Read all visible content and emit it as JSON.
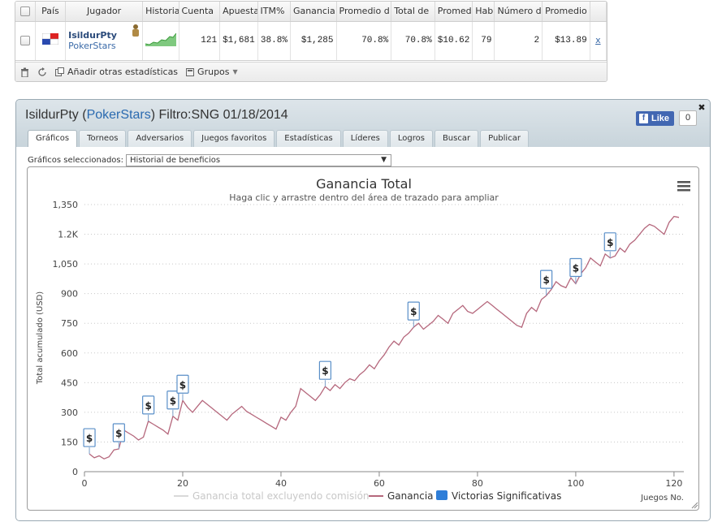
{
  "stats": {
    "headers": [
      "País",
      "Jugador",
      "Historia",
      "Cuenta",
      "Apuesta",
      "ITM%",
      "Ganancia",
      "Promedio d",
      "Total de",
      "Promedi",
      "Habil",
      "Número d",
      "Promedio"
    ],
    "row": {
      "player_name": "IsildurPty",
      "site": "PokerStars",
      "values": [
        "121",
        "$1,681",
        "38.8%",
        "$1,285",
        "70.8%",
        "70.8%",
        "$10.62",
        "79",
        "2",
        "$13.89"
      ],
      "remove": "x"
    },
    "footer": {
      "add_stats": "Añadir otras estadísticas",
      "groups": "Grupos"
    }
  },
  "window": {
    "title_player": "IsildurPty (",
    "title_site": "PokerStars",
    "title_rest": ") Filtro:SNG 01/18/2014",
    "like_label": "Like",
    "like_count": "0",
    "tabs": [
      "Gráficos",
      "Torneos",
      "Adversarios",
      "Juegos favoritos",
      "Estadísticas",
      "Líderes",
      "Logros",
      "Buscar",
      "Publicar"
    ],
    "active_tab": 0,
    "selected_label": "Gráficos seleccionados:",
    "selected_value": "Historial de beneficios"
  },
  "chart_data": {
    "type": "line",
    "title": "Ganancia Total",
    "subtitle": "Haga clic y arrastre dentro del área de trazado para ampliar",
    "xlabel": "Juegos No.",
    "ylabel": "Total acumulado (USD)",
    "xlim": [
      0,
      122
    ],
    "ylim": [
      0,
      1350
    ],
    "xticks": [
      "0",
      "20",
      "40",
      "60",
      "80",
      "100",
      "120"
    ],
    "yticks": [
      "0",
      "150",
      "300",
      "450",
      "600",
      "750",
      "900",
      "1,050",
      "1.2K",
      "1,350"
    ],
    "legend": [
      "Ganancia total excluyendo comisión",
      "Ganancia",
      "Victorias Significativas"
    ],
    "colors": {
      "ganancia": "#b5677c",
      "excl": "#d9d9d9",
      "victorias": "#2f7ed8"
    },
    "series": [
      {
        "name": "Ganancia",
        "x": [
          1,
          2,
          3,
          4,
          5,
          6,
          7,
          8,
          9,
          10,
          11,
          12,
          13,
          14,
          15,
          16,
          17,
          18,
          19,
          20,
          21,
          22,
          23,
          24,
          25,
          26,
          27,
          28,
          29,
          30,
          31,
          32,
          33,
          34,
          35,
          36,
          37,
          38,
          39,
          40,
          41,
          42,
          43,
          44,
          45,
          46,
          47,
          48,
          49,
          50,
          51,
          52,
          53,
          54,
          55,
          56,
          57,
          58,
          59,
          60,
          61,
          62,
          63,
          64,
          65,
          66,
          67,
          68,
          69,
          70,
          71,
          72,
          73,
          74,
          75,
          76,
          77,
          78,
          79,
          80,
          81,
          82,
          83,
          84,
          85,
          86,
          87,
          88,
          89,
          90,
          91,
          92,
          93,
          94,
          95,
          96,
          97,
          98,
          99,
          100,
          101,
          102,
          103,
          104,
          105,
          106,
          107,
          108,
          109,
          110,
          111,
          112,
          113,
          114,
          115,
          116,
          117,
          118,
          119,
          120,
          121
        ],
        "values": [
          90,
          70,
          80,
          65,
          75,
          110,
          115,
          210,
          195,
          180,
          160,
          175,
          255,
          240,
          225,
          210,
          190,
          280,
          260,
          360,
          325,
          300,
          330,
          360,
          340,
          320,
          300,
          280,
          260,
          290,
          310,
          330,
          305,
          290,
          275,
          260,
          245,
          230,
          215,
          275,
          260,
          300,
          330,
          420,
          400,
          380,
          360,
          390,
          430,
          410,
          440,
          420,
          450,
          470,
          460,
          490,
          510,
          540,
          520,
          560,
          590,
          630,
          660,
          640,
          680,
          700,
          730,
          750,
          720,
          740,
          760,
          790,
          770,
          750,
          800,
          820,
          840,
          810,
          800,
          820,
          840,
          860,
          840,
          820,
          800,
          780,
          760,
          740,
          730,
          800,
          830,
          810,
          870,
          890,
          920,
          960,
          940,
          930,
          980,
          950,
          1000,
          1030,
          1080,
          1060,
          1040,
          1100,
          1080,
          1090,
          1130,
          1110,
          1150,
          1170,
          1200,
          1230,
          1250,
          1240,
          1220,
          1200,
          1260,
          1290,
          1285
        ]
      }
    ],
    "significant_wins": [
      1,
      7,
      13,
      18,
      20,
      49,
      67,
      94,
      100,
      107
    ]
  }
}
